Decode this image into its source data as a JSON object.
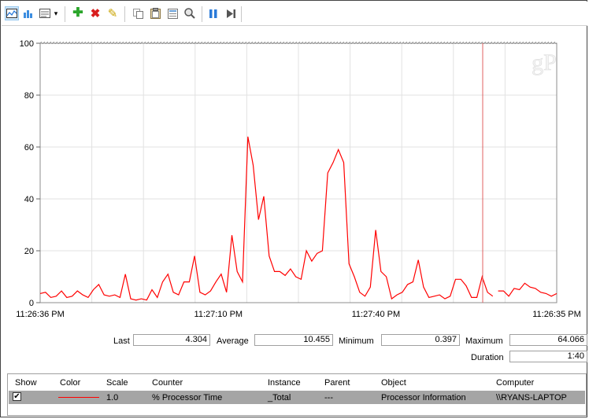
{
  "toolbar": {
    "buttons": [
      {
        "name": "view-graph-icon",
        "glyph": "📈"
      },
      {
        "name": "view-histogram-icon",
        "glyph": "▮"
      },
      {
        "name": "change-graph-type-icon",
        "glyph": "▤"
      },
      {
        "name": "dropdown-arrow-icon",
        "glyph": "▾"
      },
      {
        "name": "add-counter-icon",
        "glyph": "✚"
      },
      {
        "name": "delete-counter-icon",
        "glyph": "✖"
      },
      {
        "name": "highlight-icon",
        "glyph": "✎"
      },
      {
        "name": "copy-properties-icon",
        "glyph": "⎘"
      },
      {
        "name": "paste-counter-list-icon",
        "glyph": "📋"
      },
      {
        "name": "properties-icon",
        "glyph": "▦"
      },
      {
        "name": "zoom-icon",
        "glyph": "🔍"
      },
      {
        "name": "freeze-display-icon",
        "glyph": "❚❚"
      },
      {
        "name": "update-data-icon",
        "glyph": "▶❙"
      }
    ]
  },
  "chart_data": {
    "type": "line",
    "ylim": [
      0,
      100
    ],
    "y_ticks": [
      "0",
      "20",
      "40",
      "60",
      "80",
      "100"
    ],
    "x_ticks": [
      "11:26:36 PM",
      "11:27:10 PM",
      "11:27:40 PM",
      "11:26:35 PM"
    ],
    "gap_index": 85,
    "series": [
      {
        "color": "#ff0000",
        "values": [
          3.5,
          4,
          2,
          2.5,
          4.5,
          2,
          2.5,
          4.5,
          3,
          2,
          5,
          7,
          3,
          2.5,
          3,
          2,
          11,
          1.5,
          1,
          1.5,
          1,
          5,
          2,
          8,
          11,
          4,
          3,
          8,
          8,
          18,
          4,
          3,
          4.5,
          8,
          11,
          4,
          26,
          12,
          8,
          64,
          53,
          32,
          41,
          18,
          12,
          12,
          10.5,
          13,
          10,
          9,
          20,
          16,
          19,
          20,
          50,
          54,
          59,
          54,
          15,
          10,
          4,
          2.5,
          6,
          28,
          12,
          10,
          1.5,
          3,
          4,
          7,
          8,
          16.5,
          6,
          2,
          2.5,
          3,
          1.5,
          2.5,
          9,
          9,
          6.5,
          2,
          2,
          10,
          4,
          2.5,
          4.5,
          4.5,
          2.5,
          5.5,
          5,
          7.5,
          6,
          5.5,
          4,
          3.5,
          2.5,
          3.5
        ]
      }
    ]
  },
  "watermark": "gP",
  "stats": {
    "last_label": "Last",
    "last_value": "4.304",
    "average_label": "Average",
    "average_value": "10.455",
    "minimum_label": "Minimum",
    "minimum_value": "0.397",
    "maximum_label": "Maximum",
    "maximum_value": "64.066",
    "duration_label": "Duration",
    "duration_value": "1:40"
  },
  "legend": {
    "headers": {
      "show": "Show",
      "color": "Color",
      "scale": "Scale",
      "counter": "Counter",
      "instance": "Instance",
      "parent": "Parent",
      "object": "Object",
      "computer": "Computer"
    },
    "rows": [
      {
        "checked": "✔",
        "scale": "1.0",
        "counter": "% Processor Time",
        "instance": "_Total",
        "parent": "---",
        "object": "Processor Information",
        "computer": "\\\\RYANS-LAPTOP",
        "line_color": "#ff0000"
      }
    ]
  }
}
